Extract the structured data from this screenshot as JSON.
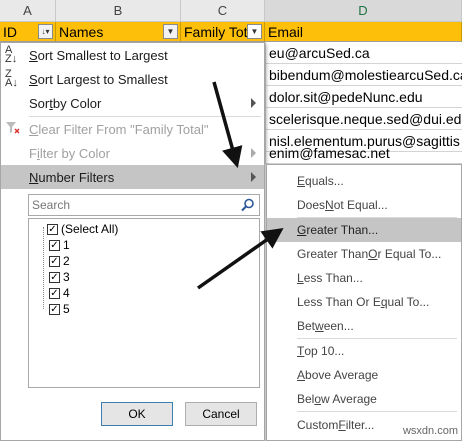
{
  "columns": {
    "a": "A",
    "b": "B",
    "c": "C",
    "d": "D"
  },
  "headers": {
    "id": "ID",
    "names": "Names",
    "family_total": "Family Tota",
    "email": "Email"
  },
  "emails": [
    "eu@arcuSed.ca",
    "bibendum@molestiearcuSed.ca",
    "dolor.sit@pedeNunc.edu",
    "scelerisque.neque.sed@dui.ed",
    "nisl.elementum.purus@sagittis",
    "enim@famesac.net"
  ],
  "menu": {
    "sort_asc_pre": "",
    "sort_asc_u": "S",
    "sort_asc_post": "ort Smallest to Largest",
    "sort_desc_pre": "",
    "sort_desc_u": "S",
    "sort_desc_post": "ort Largest to Smallest",
    "sort_color_pre": "Sor",
    "sort_color_u": "t",
    "sort_color_post": " by Color",
    "clear_filter_pre": "",
    "clear_filter_u": "C",
    "clear_filter_post": "lear Filter From \"Family Total\"",
    "filter_color_pre": "F",
    "filter_color_u": "i",
    "filter_color_post": "lter by Color",
    "number_filters_pre": "",
    "number_filters_u": "N",
    "number_filters_post": "umber Filters",
    "search_placeholder": "Search",
    "checklist": [
      "(Select All)",
      "1",
      "2",
      "3",
      "4",
      "5"
    ],
    "ok": "OK",
    "cancel": "Cancel"
  },
  "submenu": [
    {
      "pre": "",
      "u": "E",
      "post": "quals..."
    },
    {
      "pre": "Does ",
      "u": "N",
      "post": "ot Equal..."
    },
    {
      "pre": "",
      "u": "G",
      "post": "reater Than..."
    },
    {
      "pre": "Greater Than ",
      "u": "O",
      "post": "r Equal To..."
    },
    {
      "pre": "",
      "u": "L",
      "post": "ess Than..."
    },
    {
      "pre": "Less Than Or E",
      "u": "q",
      "post": "ual To..."
    },
    {
      "pre": "Bet",
      "u": "w",
      "post": "een..."
    },
    {
      "pre": "",
      "u": "T",
      "post": "op 10..."
    },
    {
      "pre": "",
      "u": "A",
      "post": "bove Average"
    },
    {
      "pre": "Bel",
      "u": "o",
      "post": "w Average"
    },
    {
      "pre": "Custom ",
      "u": "F",
      "post": "ilter..."
    }
  ],
  "watermark": "wsxdn.com",
  "colors": {
    "header_fill": "#fdbf0a",
    "highlight": "#c5c5c5",
    "arrow": "#111111"
  }
}
